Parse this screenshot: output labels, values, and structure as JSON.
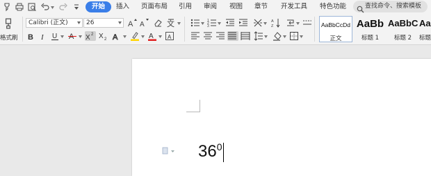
{
  "menu": {
    "tabs": [
      {
        "label": "开始",
        "active": true
      },
      {
        "label": "插入"
      },
      {
        "label": "页面布局"
      },
      {
        "label": "引用"
      },
      {
        "label": "审阅"
      },
      {
        "label": "视图"
      },
      {
        "label": "章节"
      },
      {
        "label": "开发工具"
      },
      {
        "label": "特色功能"
      }
    ],
    "search_placeholder": "查找命令、搜索模板"
  },
  "quick_access": [
    "pin-icon",
    "print-icon",
    "print-preview-icon",
    "undo-icon",
    "redo-icon",
    "customize-icon"
  ],
  "ribbon": {
    "format_painter_label": "格式刷",
    "font_name": "Calibri (正文)",
    "font_size": "26"
  },
  "styles": [
    {
      "sample": "AaBbCcDd",
      "name": "正文",
      "active": true
    },
    {
      "sample": "AaBb",
      "name": "标题 1"
    },
    {
      "sample": "AaBbC",
      "name": "标题 2"
    },
    {
      "sample": "AaBb",
      "name": "标题"
    }
  ],
  "document": {
    "text": "36",
    "superscript": "0"
  },
  "colors": {
    "accent": "#3a7ee8",
    "highlight": "#ffd400",
    "font_color": "#e02020",
    "toolbar_bg": "#f3f3f3",
    "canvas_bg": "#e9e9e9"
  }
}
